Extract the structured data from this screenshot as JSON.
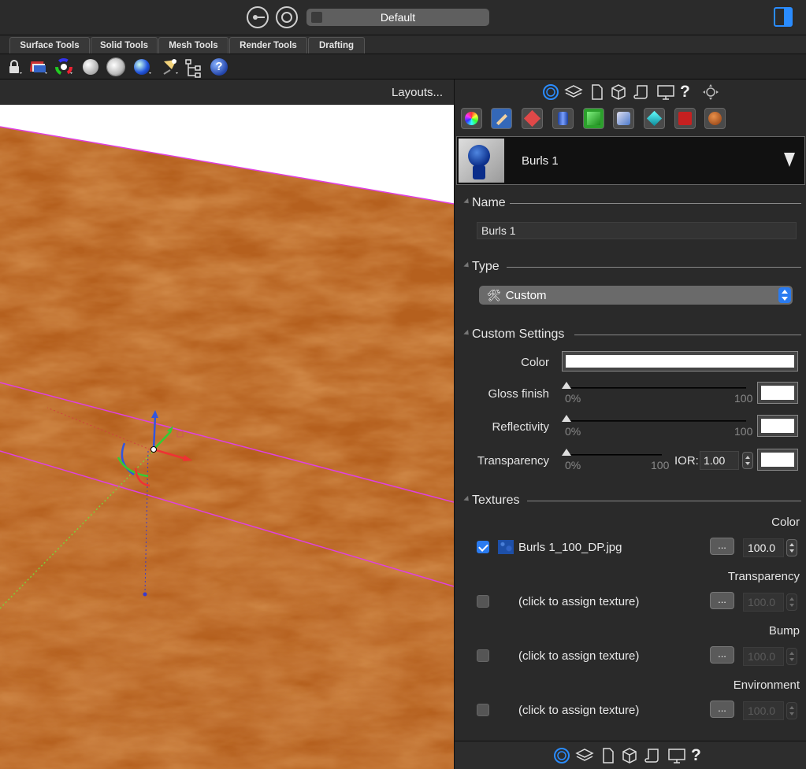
{
  "titlebar": {
    "layout_name": "Default"
  },
  "tabs": [
    {
      "label": "Surface Tools"
    },
    {
      "label": "Solid Tools"
    },
    {
      "label": "Mesh Tools"
    },
    {
      "label": "Render Tools"
    },
    {
      "label": "Drafting"
    }
  ],
  "toolbar": {
    "icons": [
      "lock-icon",
      "layers-icon",
      "color-wheel-icon",
      "sphere-icon",
      "grid-sphere-icon",
      "blue-sphere-icon",
      "spotlight-icon",
      "hierarchy-icon",
      "help-icon"
    ]
  },
  "viewport": {
    "layouts_label": "Layouts..."
  },
  "panel": {
    "tab_icons": [
      "properties-icon",
      "layers-icon",
      "page-icon",
      "object-icon",
      "scroll-icon",
      "monitor-icon",
      "help-icon",
      "move-icon"
    ],
    "material": {
      "name": "Burls 1"
    },
    "name_section": {
      "title": "Name",
      "value": "Burls 1"
    },
    "type_section": {
      "title": "Type",
      "value": "Custom"
    },
    "custom_section": {
      "title": "Custom Settings",
      "color_label": "Color",
      "color_value": "#ffffff",
      "gloss": {
        "label": "Gloss finish",
        "min_label": "0%",
        "max_label": "100",
        "value": 0
      },
      "reflectivity": {
        "label": "Reflectivity",
        "min_label": "0%",
        "max_label": "100",
        "value": 0
      },
      "transparency": {
        "label": "Transparency",
        "min_label": "0%",
        "max_label": "100",
        "value": 0
      },
      "ior_label": "IOR:",
      "ior_value": "1.00"
    },
    "textures": {
      "title": "Textures",
      "slots": [
        {
          "heading": "Color",
          "checked": true,
          "name": "Burls 1_100_DP.jpg",
          "button": "...",
          "amount": "100.0"
        },
        {
          "heading": "Transparency",
          "checked": false,
          "name": "(click to assign texture)",
          "button": "...",
          "amount": "100.0"
        },
        {
          "heading": "Bump",
          "checked": false,
          "name": "(click to assign texture)",
          "button": "...",
          "amount": "100.0"
        },
        {
          "heading": "Environment",
          "checked": false,
          "name": "(click to assign texture)",
          "button": "...",
          "amount": "100.0"
        }
      ]
    }
  }
}
